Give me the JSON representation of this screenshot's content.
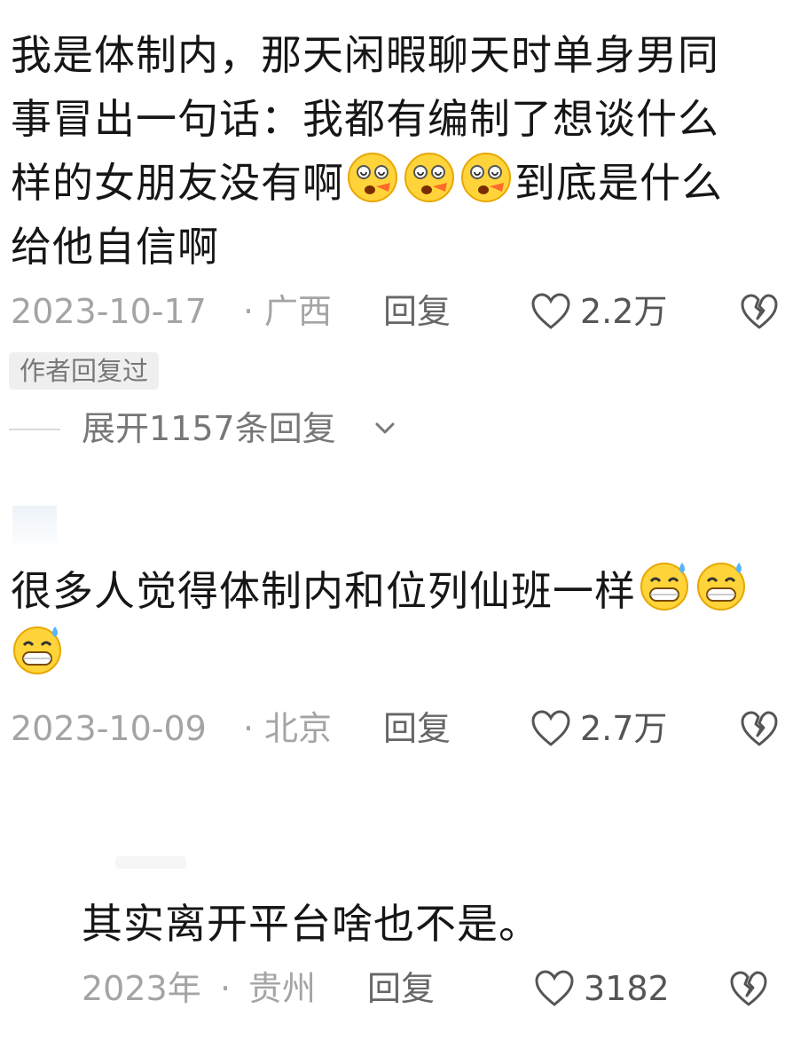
{
  "comments": [
    {
      "text_lines": [
        "我是体制内，那天闲暇聊天时单身男同",
        "事冒出一句话：我都有编制了想谈什么",
        "样的女朋友没有啊",
        "给他自信啊"
      ],
      "line3_tail": "到底是什么",
      "date": "2023-10-17",
      "separator": "·",
      "location": "广西",
      "reply_label": "回复",
      "likes": "2.2万",
      "author_badge": "作者回复过",
      "expand_label": "展开1157条回复"
    },
    {
      "text": "很多人觉得体制内和位列仙班一样",
      "date": "2023-10-09",
      "separator": "·",
      "location": "北京",
      "reply_label": "回复",
      "likes": "2.7万"
    },
    {
      "text": "其实离开平台啥也不是。",
      "date": "2023年",
      "separator": "·",
      "location": "贵州",
      "reply_label": "回复",
      "likes": "3182"
    }
  ],
  "icons": {
    "like": "heart-outline-icon",
    "dislike": "broken-heart-icon",
    "emoji_1": "dizzy-face-emoji",
    "emoji_2": "grinning-sweat-emoji",
    "expand": "chevron-down-icon"
  },
  "colors": {
    "text": "#161616",
    "meta": "#a4a4a4",
    "badge_bg": "#efefef"
  }
}
